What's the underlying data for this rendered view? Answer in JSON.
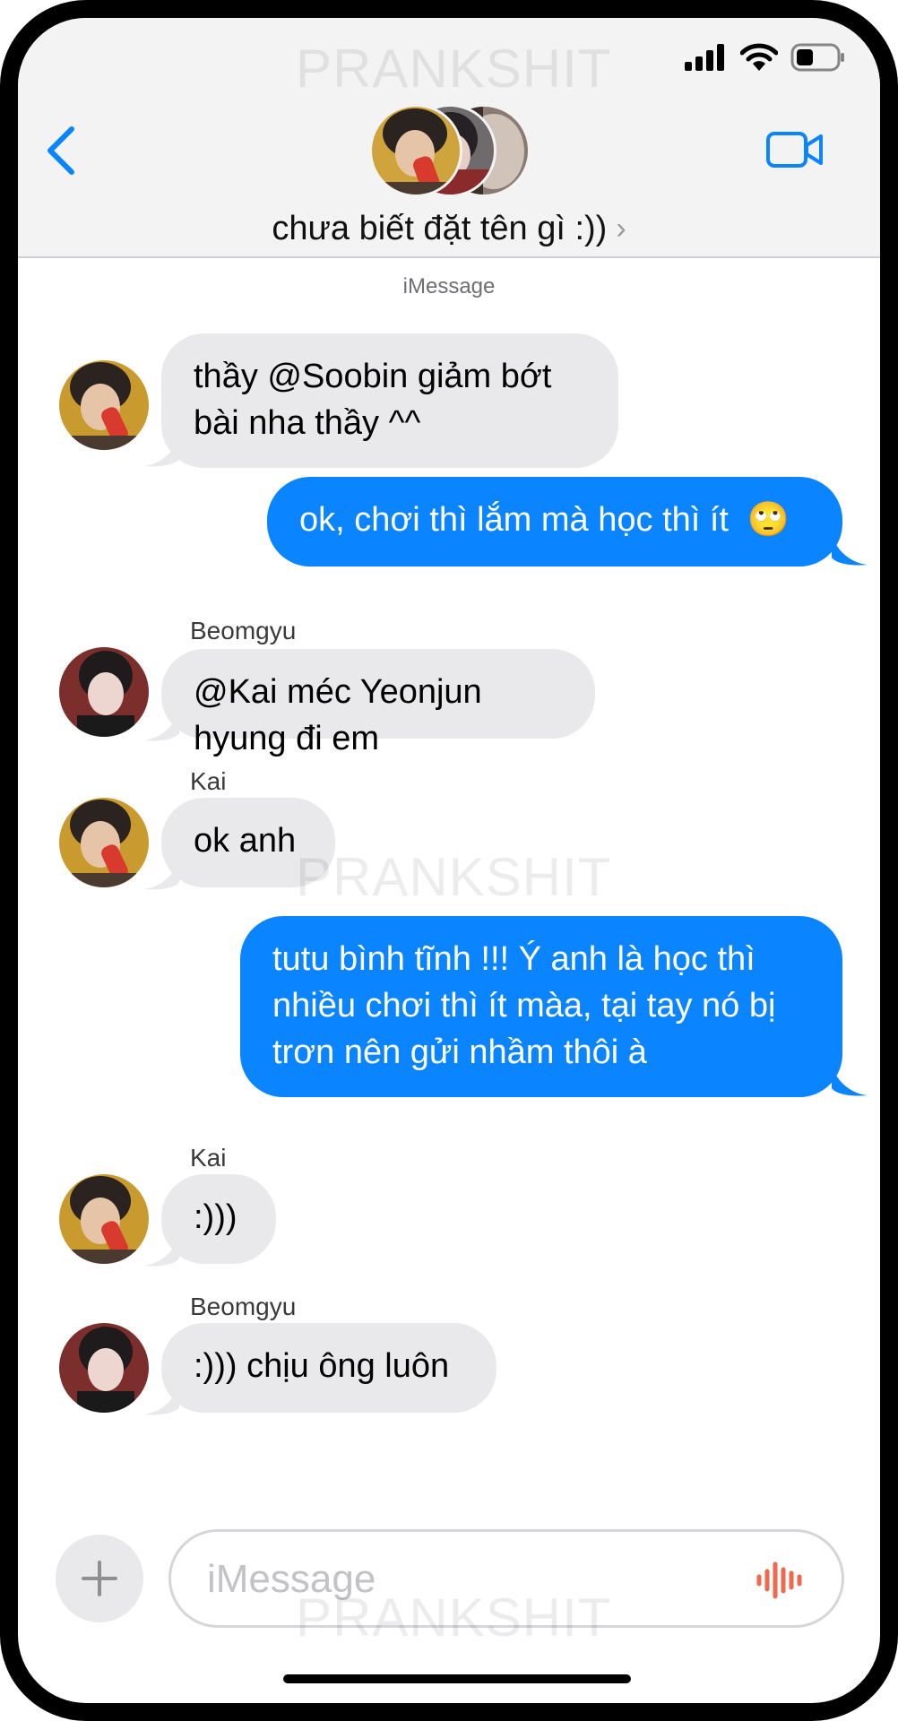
{
  "header": {
    "group_name": "chưa biết đặt tên gì :))",
    "group_chevron": "›"
  },
  "service_label": "iMessage",
  "watermark": "PRANKSHIT",
  "messages": [
    {
      "direction": "in",
      "sender": "",
      "avatar": "kai",
      "text": "thầy @Soobin giảm bớt bài nha thầy ^^"
    },
    {
      "direction": "out",
      "text": "ok, chơi thì lắm mà học thì ít",
      "emoji": "🙄"
    },
    {
      "direction": "in",
      "sender": "Beomgyu",
      "avatar": "beomgyu",
      "text": "@Kai méc Yeonjun hyung đi em"
    },
    {
      "direction": "in",
      "sender": "Kai",
      "avatar": "kai",
      "text": "ok anh"
    },
    {
      "direction": "out",
      "text": "tutu bình tĩnh !!! Ý anh là học thì nhiều chơi thì ít màa, tại tay nó bị trơn nên gửi nhầm thôi à"
    },
    {
      "direction": "in",
      "sender": "Kai",
      "avatar": "kai",
      "text": ":)))"
    },
    {
      "direction": "in",
      "sender": "Beomgyu",
      "avatar": "beomgyu",
      "text": ":))) chịu ông luôn"
    }
  ],
  "composer": {
    "placeholder": "iMessage",
    "value": ""
  },
  "icons": {
    "back": "chevron-left-icon",
    "video": "video-camera-icon",
    "add": "plus-icon",
    "audio": "waveform-icon",
    "signal": "cellular-signal-icon",
    "wifi": "wifi-icon",
    "battery": "battery-icon"
  },
  "colors": {
    "accent": "#0a84ff",
    "incoming_bubble": "#e9e9eb",
    "header_bg": "#f3f3f4",
    "waveform": "#ee6a4f"
  }
}
